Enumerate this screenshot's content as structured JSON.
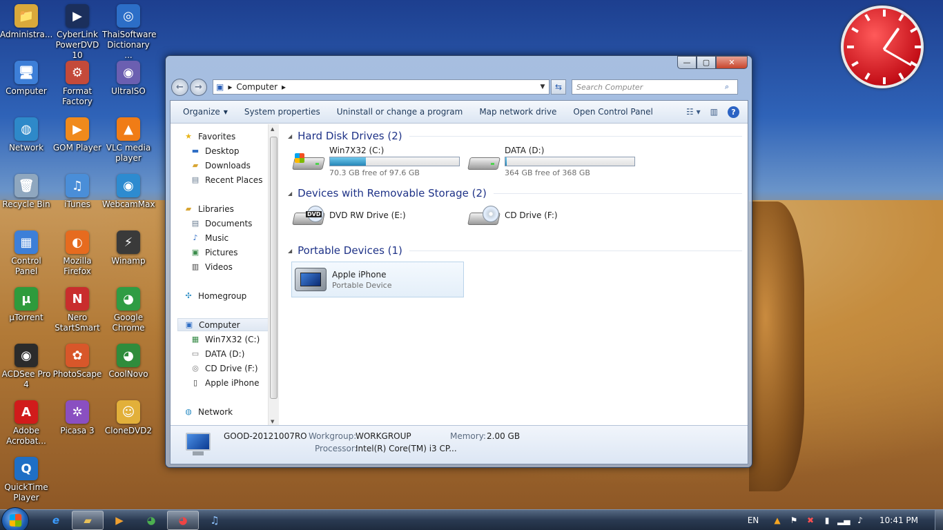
{
  "desktop": {
    "icons": [
      {
        "label": "Administra...",
        "glyph": "📁",
        "color": "#d9a93b"
      },
      {
        "label": "CyberLink PowerDVD 10",
        "glyph": "▶",
        "color": "#1b2f5c"
      },
      {
        "label": "ThaiSoftware Dictionary ...",
        "glyph": "◎",
        "color": "#2c6ec7"
      },
      {
        "label": "Computer",
        "glyph": "🖥",
        "color": "#3d7fd8"
      },
      {
        "label": "Format Factory",
        "glyph": "⚙",
        "color": "#c44a3a"
      },
      {
        "label": "UltraISO",
        "glyph": "◉",
        "color": "#6b5fb1"
      },
      {
        "label": "Network",
        "glyph": "◍",
        "color": "#2e89c9"
      },
      {
        "label": "GOM Player",
        "glyph": "▶",
        "color": "#f08a1c"
      },
      {
        "label": "VLC media player",
        "glyph": "▲",
        "color": "#f07c16"
      },
      {
        "label": "Recycle Bin",
        "glyph": "🗑",
        "color": "#8fa7bf"
      },
      {
        "label": "iTunes",
        "glyph": "♫",
        "color": "#4a8ed8"
      },
      {
        "label": "WebcamMax",
        "glyph": "◉",
        "color": "#2d8bd0"
      },
      {
        "label": "Control Panel",
        "glyph": "▦",
        "color": "#3d7fd8"
      },
      {
        "label": "Mozilla Firefox",
        "glyph": "◐",
        "color": "#e66b1f"
      },
      {
        "label": "Winamp",
        "glyph": "⚡",
        "color": "#3a3a3a"
      },
      {
        "label": "µTorrent",
        "glyph": "µ",
        "color": "#2e9b3c"
      },
      {
        "label": "Nero StartSmart",
        "glyph": "N",
        "color": "#c92d2d"
      },
      {
        "label": "Google Chrome",
        "glyph": "◕",
        "color": "#2f9c44"
      },
      {
        "label": "ACDSee Pro 4",
        "glyph": "◉",
        "color": "#2b2b2b"
      },
      {
        "label": "PhotoScape",
        "glyph": "✿",
        "color": "#d8572a"
      },
      {
        "label": "CoolNovo",
        "glyph": "◕",
        "color": "#2f8c3c"
      },
      {
        "label": "Adobe Acrobat...",
        "glyph": "A",
        "color": "#d11b1b"
      },
      {
        "label": "Picasa 3",
        "glyph": "✲",
        "color": "#8a4fc1"
      },
      {
        "label": "CloneDVD2",
        "glyph": "☺",
        "color": "#e2b03a"
      },
      {
        "label": "QuickTime Player",
        "glyph": "Q",
        "color": "#1f6fc5"
      }
    ]
  },
  "window": {
    "address": {
      "path": "Computer",
      "chevron": "▸"
    },
    "search": {
      "placeholder": "Search Computer"
    },
    "caption": {
      "min": "—",
      "max": "▢",
      "close": "✕"
    },
    "toolbar": {
      "organize": "Organize",
      "system_properties": "System properties",
      "uninstall": "Uninstall or change a program",
      "map_drive": "Map network drive",
      "open_control_panel": "Open Control Panel"
    },
    "nav": {
      "favorites": "Favorites",
      "desktop": "Desktop",
      "downloads": "Downloads",
      "recent": "Recent Places",
      "libraries": "Libraries",
      "documents": "Documents",
      "music": "Music",
      "pictures": "Pictures",
      "videos": "Videos",
      "homegroup": "Homegroup",
      "computer": "Computer",
      "c_drive": "Win7X32 (C:)",
      "d_drive": "DATA (D:)",
      "f_drive": "CD Drive (F:)",
      "iphone": "Apple iPhone",
      "network": "Network"
    },
    "groups": {
      "hdd": "Hard Disk Drives (2)",
      "removable": "Devices with Removable Storage (2)",
      "portable": "Portable Devices (1)"
    },
    "drives": {
      "c": {
        "name": "Win7X32 (C:)",
        "free": "70.3 GB free of 97.6 GB",
        "used_fraction": 0.28
      },
      "d": {
        "name": "DATA (D:)",
        "free": "364 GB free of 368 GB",
        "used_fraction": 0.01
      },
      "e": {
        "name": "DVD RW Drive (E:)",
        "badge": "DVD"
      },
      "f": {
        "name": "CD Drive (F:)"
      }
    },
    "device": {
      "name": "Apple iPhone",
      "type": "Portable Device"
    },
    "details": {
      "computer_name": "GOOD-20121007RO",
      "workgroup_label": "Workgroup:",
      "workgroup": "WORKGROUP",
      "memory_label": "Memory:",
      "memory": "2.00 GB",
      "processor_label": "Processor:",
      "processor": "Intel(R) Core(TM) i3 CP..."
    }
  },
  "taskbar": {
    "language": "EN",
    "time": "10:41 PM"
  }
}
